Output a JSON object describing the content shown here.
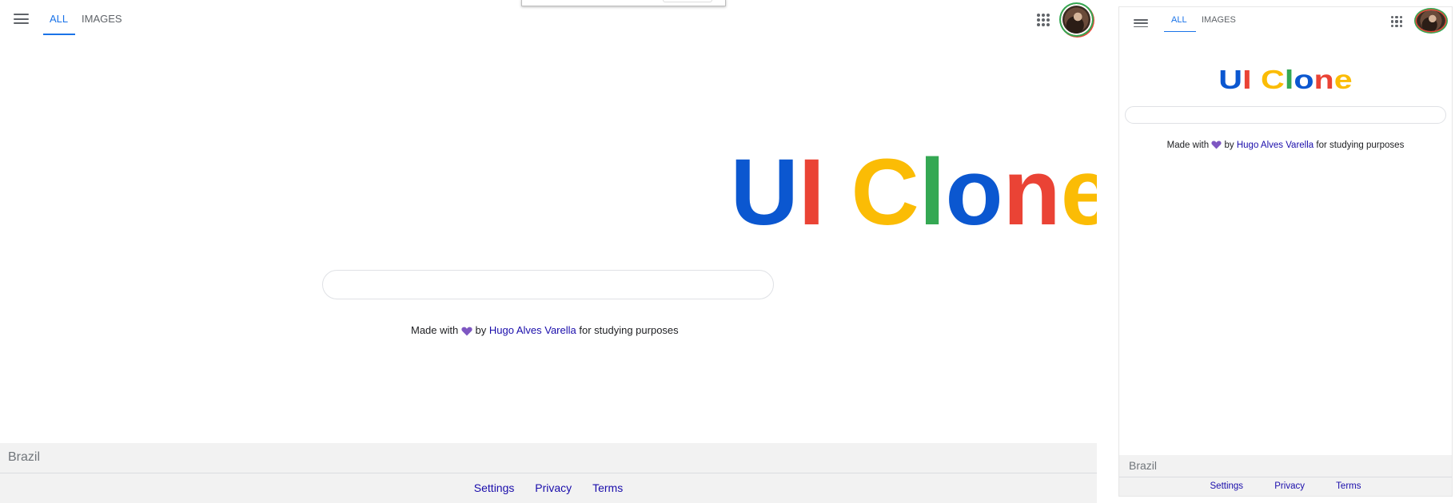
{
  "nav": {
    "tabs": [
      {
        "label": "ALL",
        "active": true
      },
      {
        "label": "IMAGES",
        "active": false
      }
    ],
    "menu_icon": "hamburger-menu-icon",
    "apps_icon": "apps-grid-icon",
    "avatar": "user-avatar"
  },
  "logo": {
    "letters": [
      {
        "char": "U",
        "color": "#0b57d0"
      },
      {
        "char": "I",
        "color": "#ea4335"
      },
      {
        "char": " ",
        "color": "#000000"
      },
      {
        "char": "C",
        "color": "#fbbc05"
      },
      {
        "char": "l",
        "color": "#34a853"
      },
      {
        "char": "o",
        "color": "#0b57d0"
      },
      {
        "char": "n",
        "color": "#ea4335"
      },
      {
        "char": "e",
        "color": "#fbbc05"
      }
    ]
  },
  "search": {
    "value": "",
    "placeholder": ""
  },
  "credit": {
    "prefix": "Made with",
    "heart_icon": "purple-heart-icon",
    "by": "by",
    "author": "Hugo Alves Varella",
    "suffix": "for studying purposes"
  },
  "footer": {
    "country": "Brazil",
    "links": [
      "Settings",
      "Privacy",
      "Terms"
    ]
  },
  "colors": {
    "accent": "#1a73e8",
    "link": "#1a0dab",
    "footer_bg": "#f2f2f2",
    "heart": "#7e57c2"
  }
}
